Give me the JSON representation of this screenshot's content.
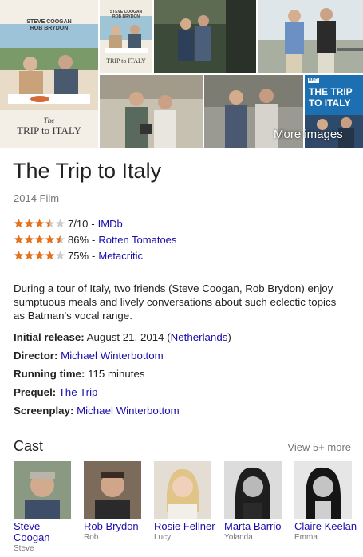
{
  "images": {
    "more_images_label": "More images",
    "poster_main": {
      "top_text": "STEVE COOGAN",
      "second_text": "ROB BRYDON",
      "title_text": "TRIP to ITALY",
      "title_prefix": "The"
    },
    "poster_small": {
      "top_text": "STEVE COOGAN",
      "second_text": "ROB BRYDON",
      "title_text": "TRIP to ITALY"
    },
    "poster_bbc": {
      "badge": "BBC",
      "title_line1": "THE TRIP",
      "title_line2": "TO ITALY"
    }
  },
  "title": "The Trip to Italy",
  "subtitle": "2014 Film",
  "ratings": [
    {
      "score": "7/10",
      "source": "IMDb",
      "stars": 3.5
    },
    {
      "score": "86%",
      "source": "Rotten Tomatoes",
      "stars": 4.5
    },
    {
      "score": "75%",
      "source": "Metacritic",
      "stars": 4
    }
  ],
  "description": "During a tour of Italy, two friends (Steve Coogan, Rob Brydon) enjoy sumptuous meals and lively conversations about such eclectic topics as Batman's vocal range.",
  "facts": {
    "release_label": "Initial release:",
    "release_value": "August 21, 2014",
    "release_place": "Netherlands",
    "director_label": "Director:",
    "director_value": "Michael Winterbottom",
    "running_label": "Running time:",
    "running_value": "115 minutes",
    "prequel_label": "Prequel:",
    "prequel_value": "The Trip",
    "screenplay_label": "Screenplay:",
    "screenplay_value": "Michael Winterbottom"
  },
  "cast": {
    "heading": "Cast",
    "more": "View 5+ more",
    "members": [
      {
        "name": "Steve Coogan",
        "role": "Steve"
      },
      {
        "name": "Rob Brydon",
        "role": "Rob"
      },
      {
        "name": "Rosie Fellner",
        "role": "Lucy"
      },
      {
        "name": "Marta Barrio",
        "role": "Yolanda"
      },
      {
        "name": "Claire Keelan",
        "role": "Emma"
      }
    ]
  },
  "colors": {
    "link": "#1a0dab",
    "star": "#e7711b",
    "star_empty": "#cccccc",
    "muted": "#777777"
  }
}
